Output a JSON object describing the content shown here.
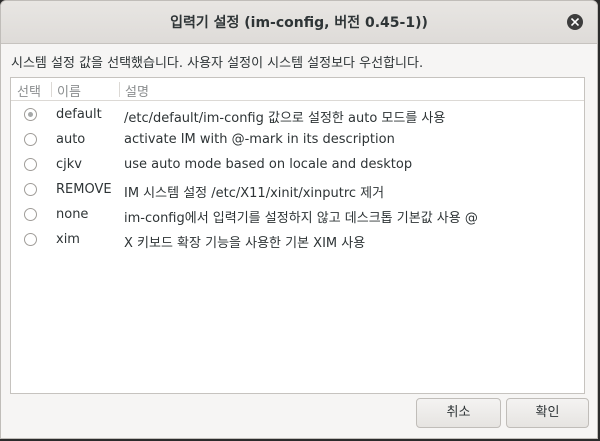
{
  "window": {
    "title": "입력기 설정 (im-config, 버전 0.45-1))",
    "close_icon": "close-icon"
  },
  "message": "시스템 설정 값을 선택했습니다. 사용자 설정이 시스템 설정보다 우선합니다.",
  "list": {
    "columns": [
      "선택",
      "이름",
      "설명"
    ],
    "rows": [
      {
        "selected": true,
        "name": "default",
        "description": "/etc/default/im-config 값으로 설정한 auto 모드를 사용"
      },
      {
        "selected": false,
        "name": "auto",
        "description": "activate IM with @-mark in its description"
      },
      {
        "selected": false,
        "name": "cjkv",
        "description": "use auto mode based on locale and desktop"
      },
      {
        "selected": false,
        "name": "REMOVE",
        "description": "IM 시스템 설정 /etc/X11/xinit/xinputrc 제거"
      },
      {
        "selected": false,
        "name": "none",
        "description": "im-config에서 입력기를 설정하지 않고 데스크톱 기본값 사용 @"
      },
      {
        "selected": false,
        "name": "xim",
        "description": "X 키보드 확장 기능을 사용한 기본 XIM 사용"
      }
    ]
  },
  "buttons": {
    "cancel": "취소",
    "ok": "확인"
  }
}
